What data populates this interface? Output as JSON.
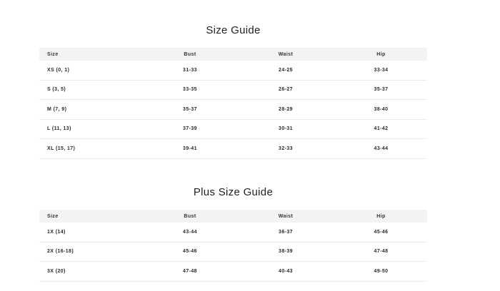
{
  "size_guide": {
    "title": "Size Guide",
    "headers": [
      "Size",
      "Bust",
      "Waist",
      "Hip"
    ],
    "rows": [
      [
        "XS (0, 1)",
        "31-33",
        "24-25",
        "33-34"
      ],
      [
        "S (3, 5)",
        "33-35",
        "26-27",
        "35-37"
      ],
      [
        "M (7, 9)",
        "35-37",
        "28-29",
        "38-40"
      ],
      [
        "L (11, 13)",
        "37-39",
        "30-31",
        "41-42"
      ],
      [
        "XL (15, 17)",
        "39-41",
        "32-33",
        "43-44"
      ]
    ]
  },
  "plus_size_guide": {
    "title": "Plus Size Guide",
    "headers": [
      "Size",
      "Bust",
      "Waist",
      "Hip"
    ],
    "rows": [
      [
        "1X (14)",
        "43-44",
        "36-37",
        "45-46"
      ],
      [
        "2X (16-18)",
        "45-46",
        "38-39",
        "47-48"
      ],
      [
        "3X (20)",
        "47-48",
        "40-43",
        "49-50"
      ]
    ]
  }
}
